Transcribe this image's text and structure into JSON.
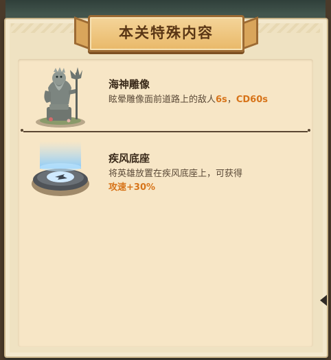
{
  "panel": {
    "title": "本关特殊内容"
  },
  "items": [
    {
      "name": "海神雕像",
      "desc_prefix": "眩晕雕像面前道路上的敌人",
      "desc_hl_1": "6s",
      "desc_sep": "，",
      "desc_hl_2": "CD60s",
      "icon": "poseidon-statue-icon"
    },
    {
      "name": "疾风底座",
      "desc_prefix": "将英雄放置在疾风底座上，可获得",
      "desc_hl_1": "攻速+30%",
      "icon": "gale-pedestal-icon"
    }
  ],
  "colors": {
    "highlight": "#d7741a",
    "title_text": "#5a3615",
    "parchment": "#f7e6c6"
  }
}
